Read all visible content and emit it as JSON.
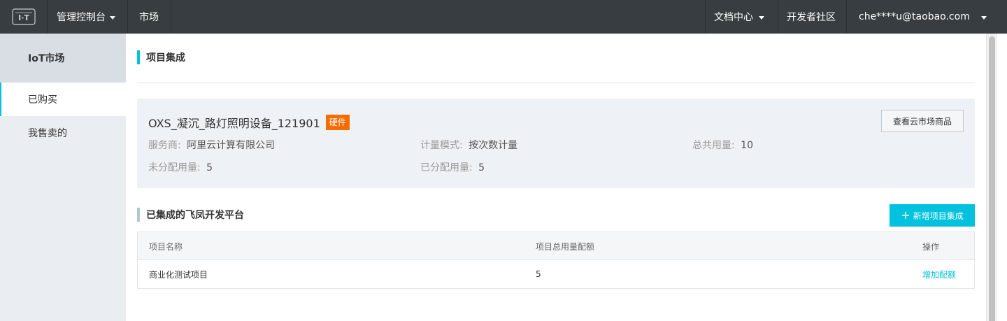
{
  "topbar": {
    "logo_icon": "iot-logo-icon",
    "console_label": "管理控制台",
    "market_label": "市场",
    "docs_label": "文档中心",
    "community_label": "开发者社区",
    "user_email": "che****u@taobao.com"
  },
  "sidebar": {
    "header": "IoT市场",
    "items": [
      {
        "label": "已购买",
        "active": true
      },
      {
        "label": "我售卖的",
        "active": false
      }
    ]
  },
  "main": {
    "section_title": "项目集成",
    "product": {
      "name": "OXS_凝沉_路灯照明设备_121901",
      "badge": "硬件",
      "view_button": "查看云市场商品",
      "provider_label": "服务商:",
      "provider_value": "阿里云计算有限公司",
      "billing_label": "计量模式:",
      "billing_value": "按次数计量",
      "total_label": "总共用量:",
      "total_value": "10",
      "unallocated_label": "未分配用量:",
      "unallocated_value": "5",
      "allocated_label": "已分配用量:",
      "allocated_value": "5"
    },
    "integrated_title": "已集成的飞凤开发平台",
    "add_button": "新增项目集成",
    "table": {
      "columns": [
        "项目名称",
        "项目总用量配额",
        "操作"
      ],
      "rows": [
        {
          "name": "商业化测试项目",
          "quota": "5",
          "action": "增加配额"
        }
      ]
    }
  },
  "colors": {
    "accent": "#00c1de",
    "topbar_bg": "#373d41",
    "badge": "#f76b00",
    "sidebar_bg": "#eaedf1"
  }
}
